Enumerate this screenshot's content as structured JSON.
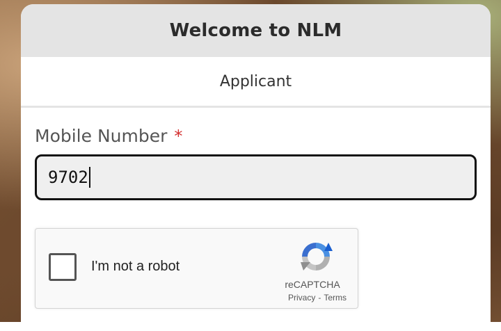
{
  "header": {
    "title": "Welcome to NLM"
  },
  "tabs": {
    "active_label": "Applicant"
  },
  "form": {
    "mobile_label": "Mobile Number",
    "required_marker": "*",
    "mobile_value": "9702"
  },
  "captcha": {
    "checkbox_label": "I'm not a robot",
    "brand": "reCAPTCHA",
    "privacy_link": "Privacy",
    "separator": "-",
    "terms_link": "Terms",
    "icon": "recaptcha-logo-icon",
    "checked": false
  },
  "colors": {
    "header_bg": "#e4e4e4",
    "required": "#d32f2f",
    "input_bg": "#efefef",
    "captcha_blue": "#4a90e2",
    "captcha_grey": "#b0b0b0"
  }
}
